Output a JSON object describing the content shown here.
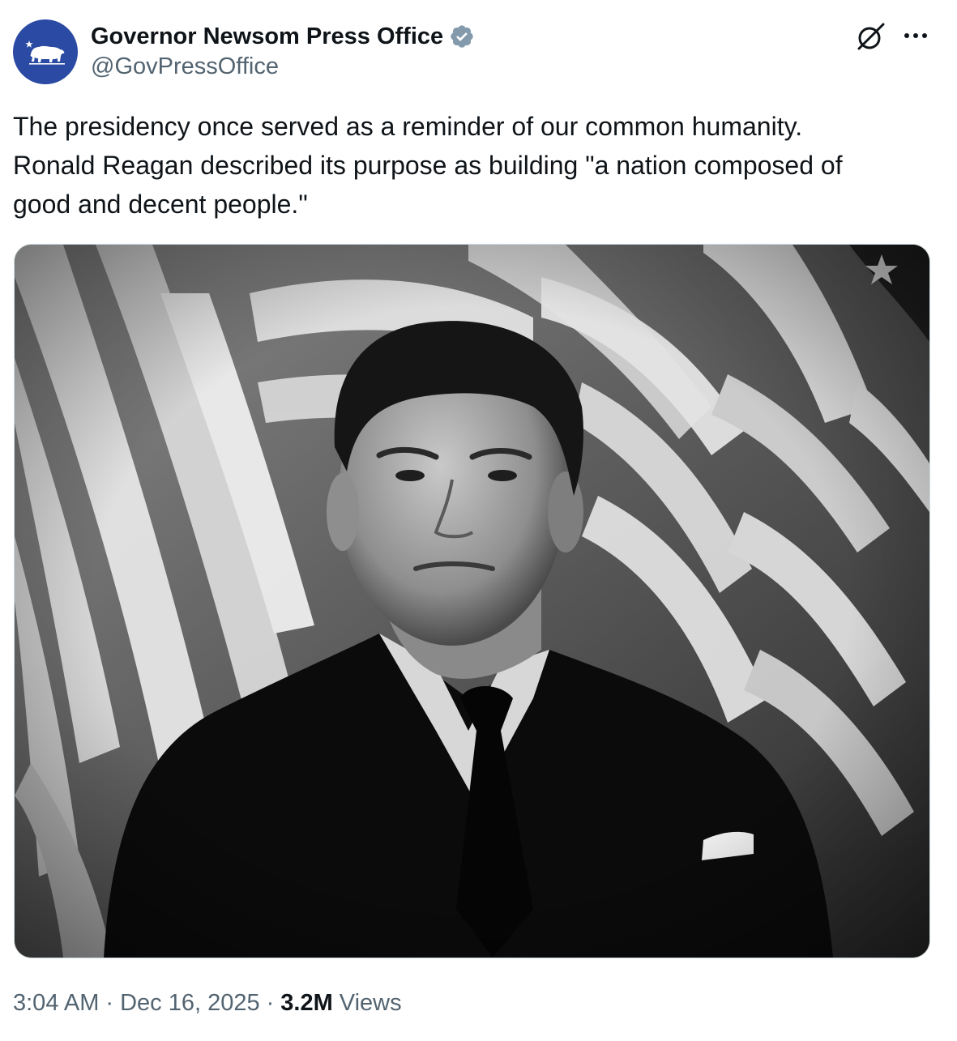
{
  "author": {
    "display_name": "Governor Newsom Press Office",
    "handle": "@GovPressOffice",
    "verified": true,
    "avatar_icon": "california-bear-icon",
    "avatar_color": "#2a4aa3",
    "verified_color": "#829aab"
  },
  "tweet": {
    "text": "The presidency once served as a reminder of our common humanity.\nRonald Reagan described its purpose as building \"a nation composed of\ngood and decent people.\""
  },
  "media": {
    "type": "photo",
    "subject": "black-and-white-portrait-with-american-flags"
  },
  "meta": {
    "time": "3:04 AM",
    "date": "Dec 16, 2025",
    "separator": "·",
    "views_count": "3.2M",
    "views_label": "Views"
  },
  "actions": {
    "grok_icon": "grok-icon",
    "more_icon": "more-dots-icon"
  },
  "colors": {
    "text_primary": "#0f1419",
    "text_secondary": "#536471",
    "border": "#cfd9de"
  }
}
